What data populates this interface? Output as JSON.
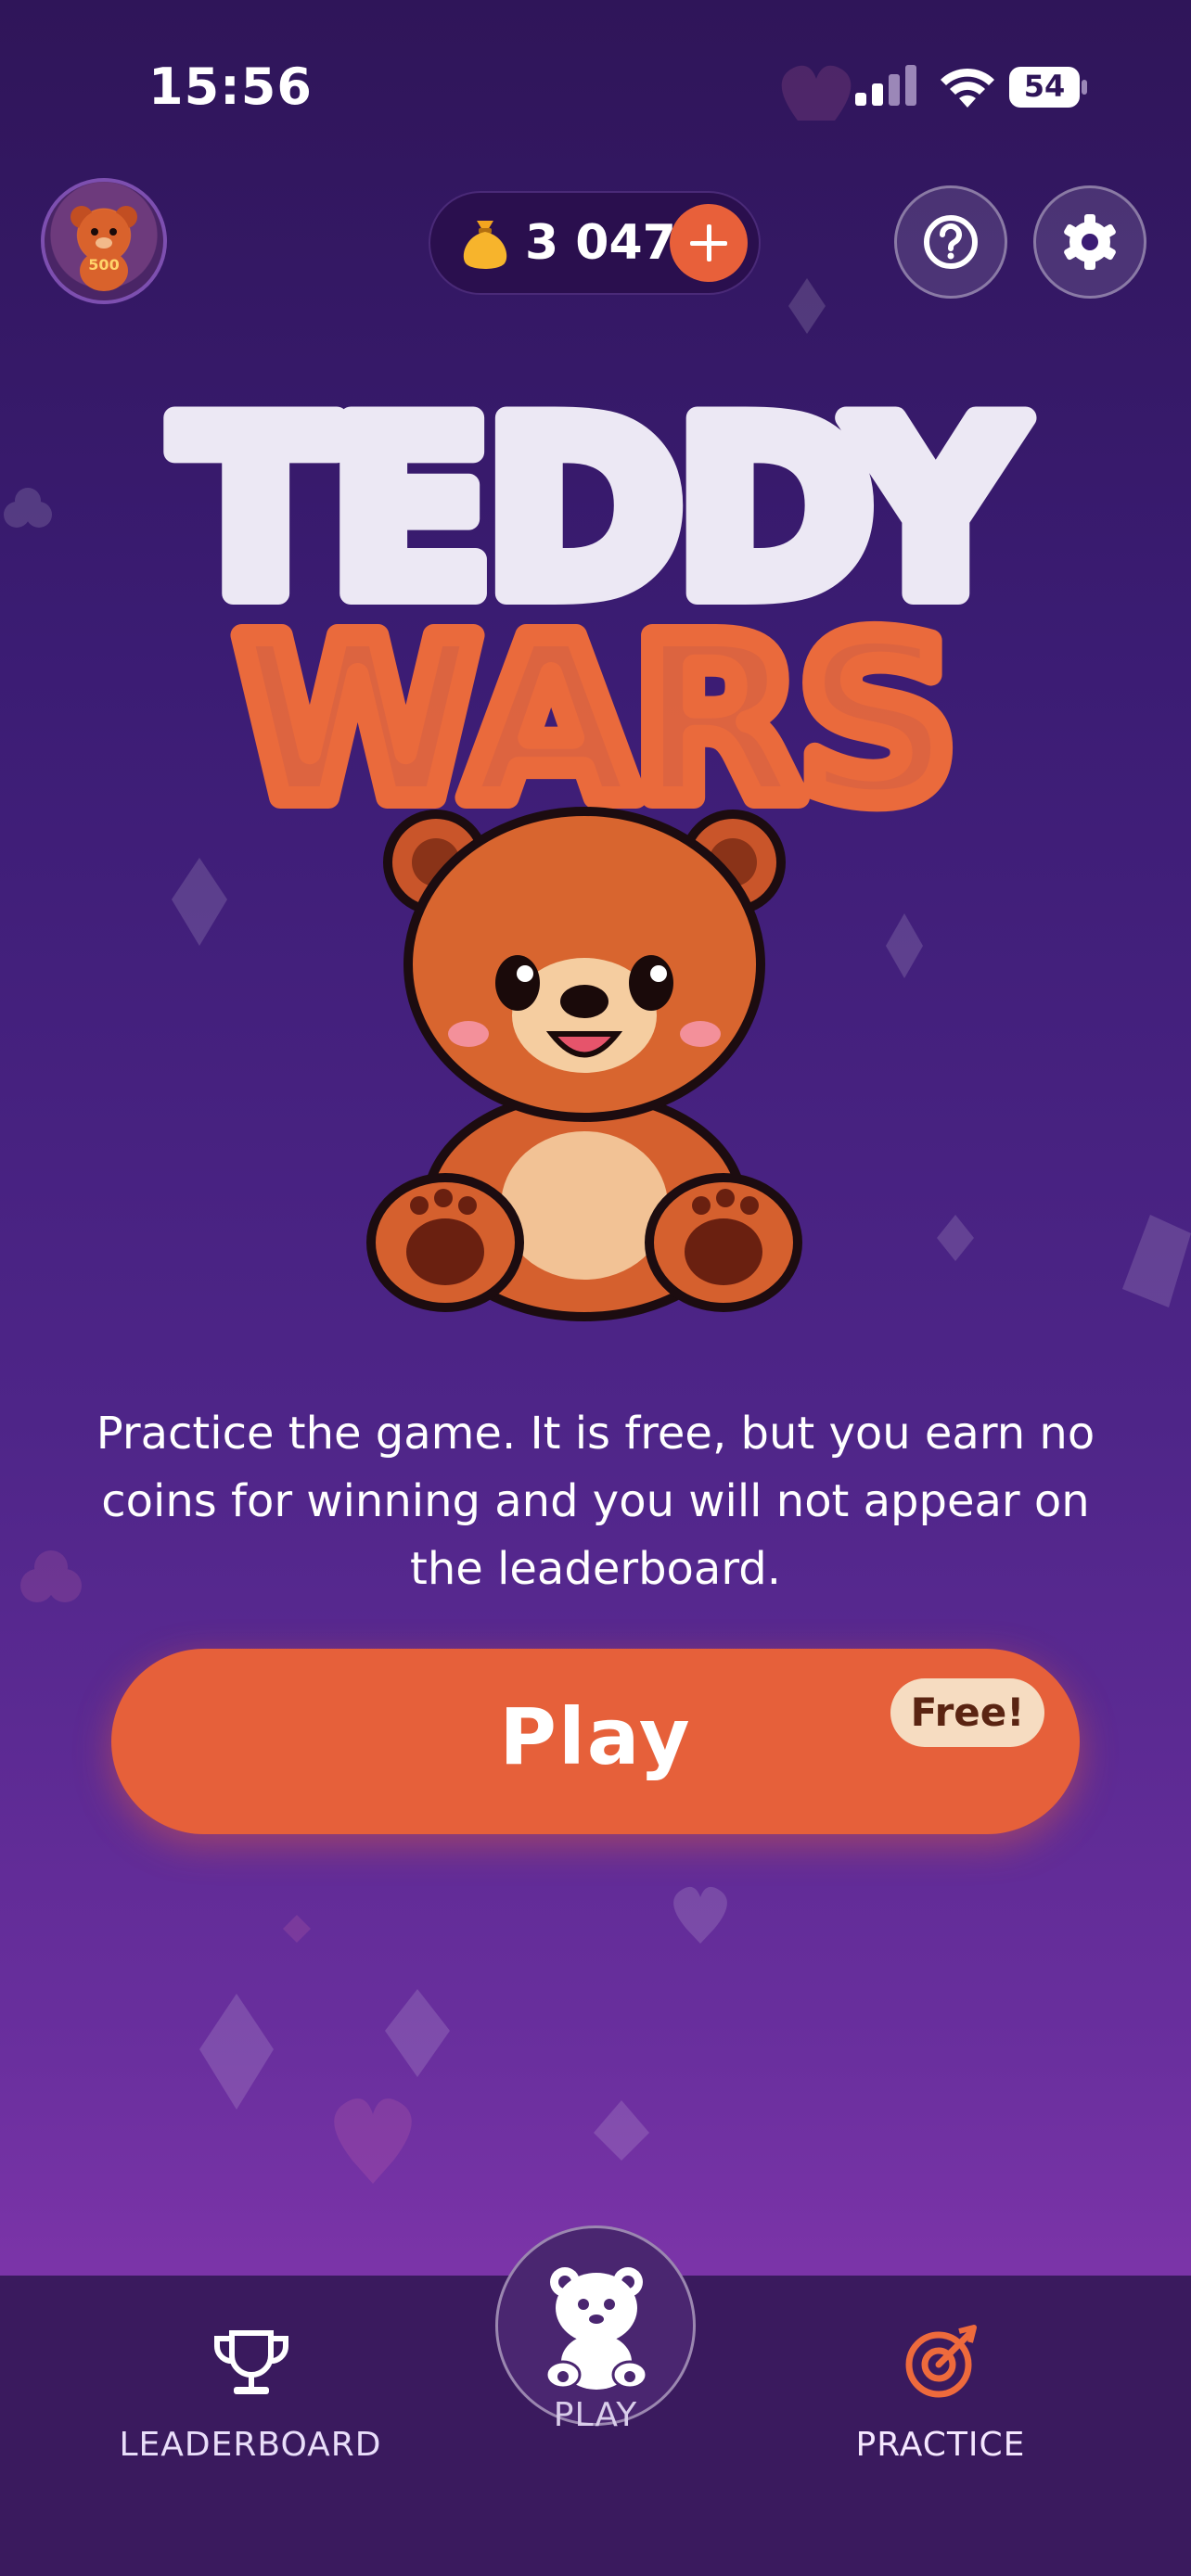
{
  "status_bar": {
    "time": "15:56",
    "battery": "54"
  },
  "header": {
    "avatar_badge": "500",
    "coins": "3 047",
    "icons": {
      "coin": "money-bag-icon",
      "add": "plus-icon",
      "help": "question-icon",
      "settings": "gear-icon"
    }
  },
  "logo": {
    "line1": "TEDDY",
    "line2": "WARS"
  },
  "main": {
    "description": "Practice the game. It is free, but you earn no coins for winning and you will not appear on the leaderboard.",
    "play_label": "Play",
    "free_badge": "Free!"
  },
  "nav": {
    "items": [
      {
        "label": "LEADERBOARD",
        "icon": "trophy-icon"
      },
      {
        "label": "PLAY",
        "icon": "bear-icon"
      },
      {
        "label": "PRACTICE",
        "icon": "target-icon"
      }
    ],
    "active": "PRACTICE"
  },
  "colors": {
    "accent": "#e6603a",
    "background_top": "#2f1559",
    "background_bottom": "#7b34a8",
    "nav_background": "#3a1a5e",
    "logo_white": "#ece8f4",
    "logo_orange": "#ea6a3c"
  }
}
